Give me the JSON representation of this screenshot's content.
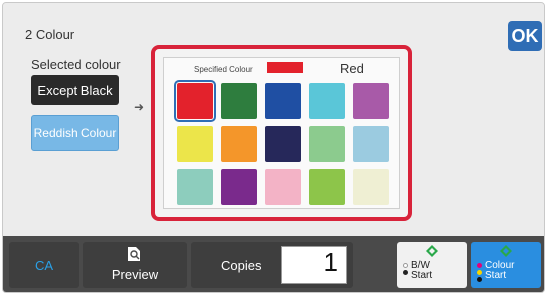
{
  "header": {
    "title": "2 Colour",
    "ok_label": "OK"
  },
  "left": {
    "selected_label": "Selected colour",
    "except_black_label": "Except Black",
    "reddish_label": "Reddish Colour",
    "arrow_icon": "arrow-right"
  },
  "palette": {
    "specified_label": "Specified Colour",
    "specified_name": "Red",
    "specified_color": "#e3222c",
    "selected_index": 0,
    "swatches": [
      "#e3222c",
      "#2e7d3e",
      "#1f4fa3",
      "#5ac6d8",
      "#a85aa8",
      "#ece54a",
      "#f4962a",
      "#26285a",
      "#8ccb8e",
      "#9bcbe0",
      "#8dcdbd",
      "#7a2a8c",
      "#f3b3c6",
      "#8dc54a",
      "#efefd3"
    ]
  },
  "bottom": {
    "ca_label": "CA",
    "preview_label": "Preview",
    "copies_label": "Copies",
    "copies_value": "1",
    "bw_line1": "B/W",
    "bw_line2": "Start",
    "colour_line1": "Colour",
    "colour_line2": "Start"
  },
  "colors": {
    "accent_blue": "#2f6db5",
    "highlight_red": "#d8233a",
    "colour_start_bg": "#2a8ee0"
  }
}
